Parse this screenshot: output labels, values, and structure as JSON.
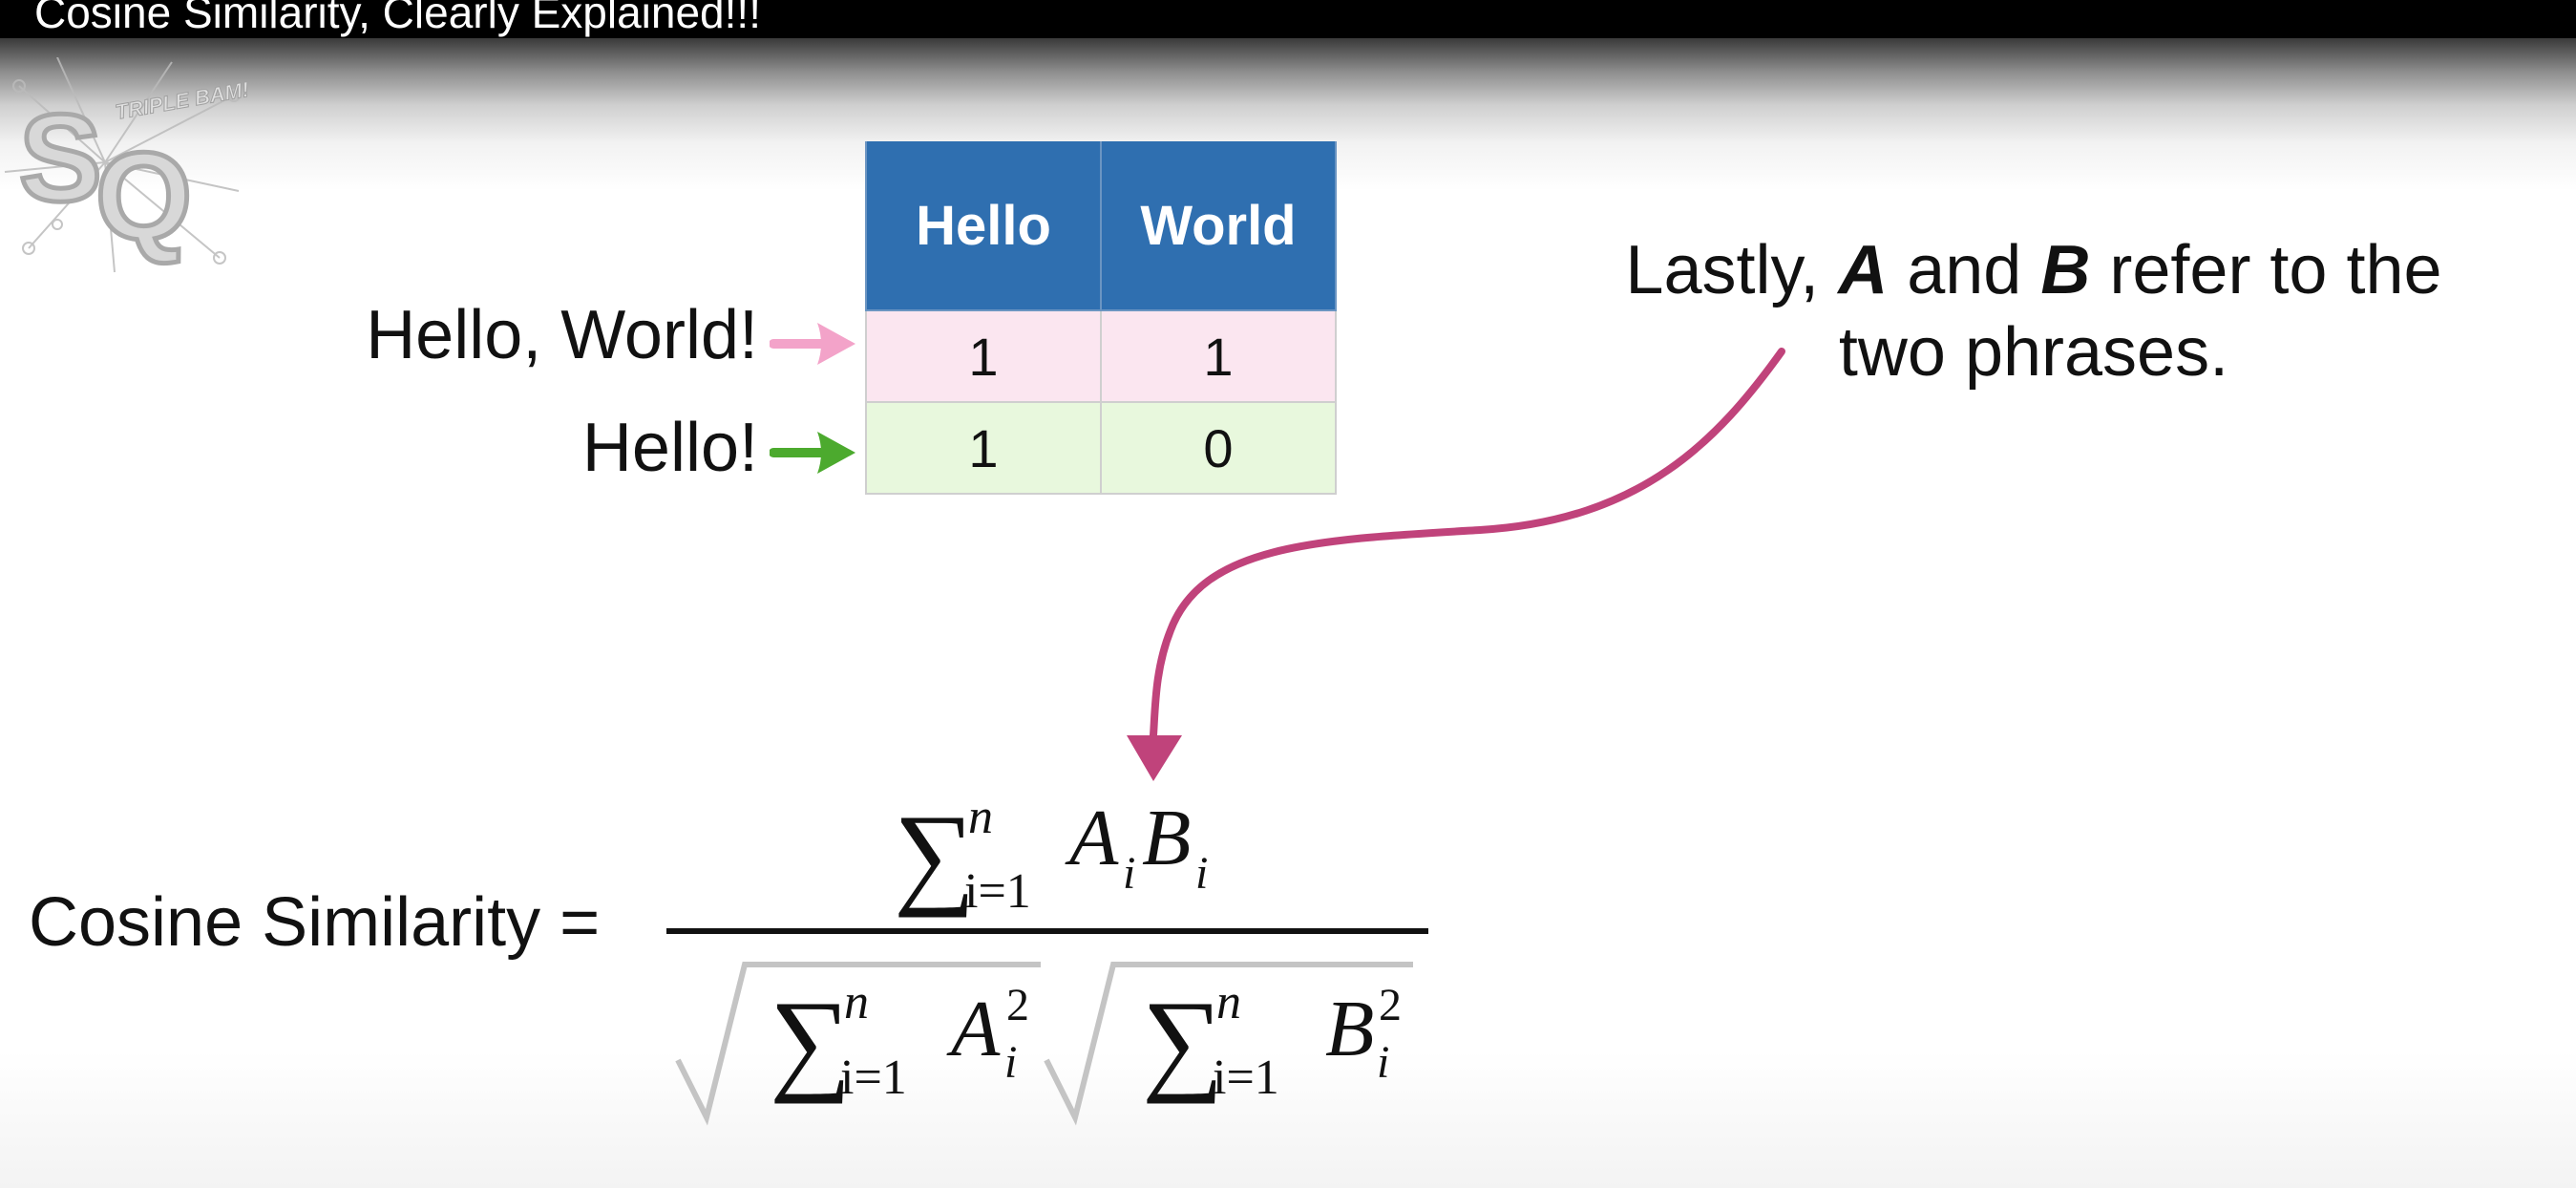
{
  "video": {
    "title": "Cosine Similarity, Clearly Explained!!!"
  },
  "logo": {
    "letters": "SQ",
    "burst_text": "TRIPLE BAM!!!"
  },
  "table": {
    "columns": [
      "Hello",
      "World"
    ],
    "rows": [
      {
        "label": "Hello, World!",
        "values": [
          "1",
          "1"
        ],
        "arrow_color": "#f3a3c9"
      },
      {
        "label": "Hello!",
        "values": [
          "1",
          "0"
        ],
        "arrow_color": "#4caa2e"
      }
    ],
    "header_color": "#2f6fb0"
  },
  "caption": {
    "prefix": "Lastly,",
    "var_a": "A",
    "mid": "and",
    "var_b": "B",
    "suffix_line1": "refer to the",
    "line2": "two phrases."
  },
  "equation": {
    "lhs": "Cosine Similarity =",
    "sum_symbol": "∑",
    "upper": "n",
    "lower": "i=1",
    "num_a": "A",
    "num_b": "B",
    "sub": "i",
    "sup": "2"
  },
  "colors": {
    "curve": "#c0437b"
  }
}
